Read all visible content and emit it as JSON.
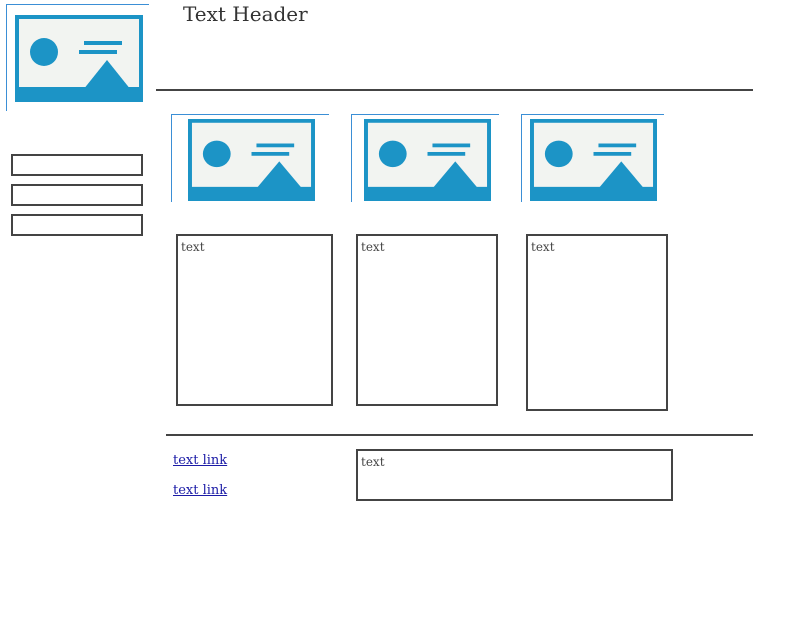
{
  "header": {
    "title": "Text Header"
  },
  "cards": [
    {
      "text": "text"
    },
    {
      "text": "text"
    },
    {
      "text": "text"
    }
  ],
  "footer": {
    "links": [
      "text link",
      "text link"
    ],
    "text": "text"
  },
  "colors": {
    "image_accent": "#1c94c6",
    "image_background": "#ecefea",
    "frame_line": "#3b8fd6",
    "border": "#444444",
    "link": "#1a1aa6"
  },
  "icons": [
    "image-placeholder-icon"
  ]
}
